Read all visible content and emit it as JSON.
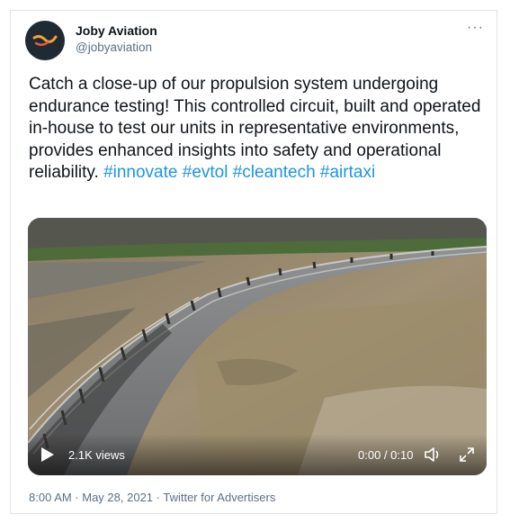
{
  "author": {
    "name": "Joby Aviation",
    "handle": "@jobyaviation"
  },
  "more_label": "···",
  "tweet": {
    "text": "Catch a close-up of our propulsion system undergoing endurance testing! This controlled circuit, built and operated in-house to test our units in representative environments, provides enhanced insights into safety and operational reliability.",
    "hashtags": [
      "#innovate",
      "#evtol",
      "#cleantech",
      "#airtaxi"
    ]
  },
  "video": {
    "views": "2.1K views",
    "time": "0:00 / 0:10"
  },
  "meta": {
    "text": "8:00 AM · May 28, 2021 · Twitter for Advertisers"
  },
  "colors": {
    "link": "#1b95e0",
    "secondary_text": "#5b7083",
    "avatar_bg": "#1f2a33",
    "logo": "#f0a13a"
  }
}
